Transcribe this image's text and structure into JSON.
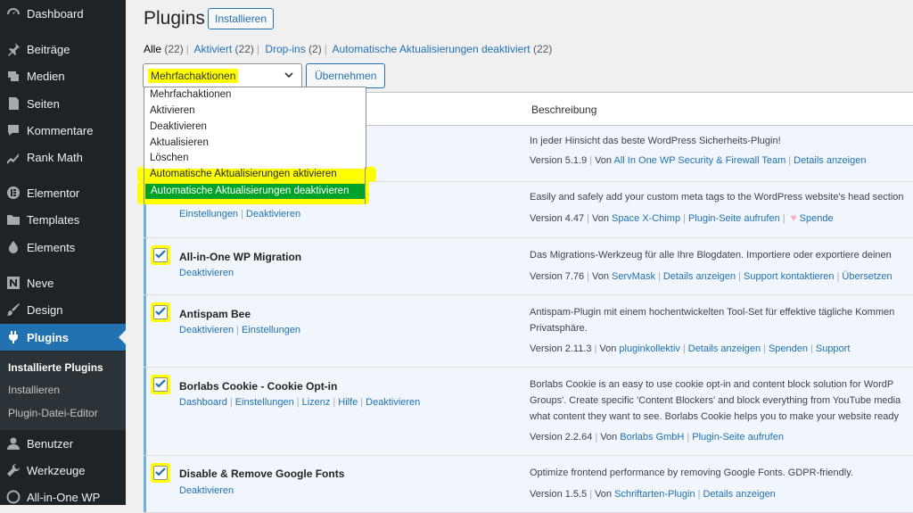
{
  "sidebar": {
    "items": [
      {
        "label": "Dashboard",
        "icon": "dashboard-icon"
      },
      {
        "label": "Beiträge",
        "icon": "pin-icon"
      },
      {
        "label": "Medien",
        "icon": "media-icon"
      },
      {
        "label": "Seiten",
        "icon": "page-icon"
      },
      {
        "label": "Kommentare",
        "icon": "comment-icon"
      },
      {
        "label": "Rank Math",
        "icon": "chart-icon"
      },
      {
        "label": "Elementor",
        "icon": "elementor-icon"
      },
      {
        "label": "Templates",
        "icon": "folder-icon"
      },
      {
        "label": "Elements",
        "icon": "elements-icon"
      },
      {
        "label": "Neve",
        "icon": "neve-icon"
      },
      {
        "label": "Design",
        "icon": "brush-icon"
      },
      {
        "label": "Plugins",
        "icon": "plug-icon"
      },
      {
        "label": "Benutzer",
        "icon": "user-icon"
      },
      {
        "label": "Werkzeuge",
        "icon": "wrench-icon"
      },
      {
        "label": "All-in-One WP",
        "icon": "shield-icon"
      }
    ],
    "submenu": [
      "Installierte Plugins",
      "Installieren",
      "Plugin-Datei-Editor"
    ]
  },
  "header": {
    "title": "Plugins",
    "add_button": "Installieren"
  },
  "filters": {
    "all": "Alle",
    "all_count": "(22)",
    "active": "Aktiviert",
    "active_count": "(22)",
    "dropins": "Drop-ins",
    "dropins_count": "(2)",
    "autoupdate": "Automatische Aktualisierungen deaktiviert",
    "autoupdate_count": "(22)",
    "sep": "|"
  },
  "bulk": {
    "selected": "Mehrfachaktionen",
    "apply": "Übernehmen",
    "options": [
      "Mehrfachaktionen",
      "Aktivieren",
      "Deaktivieren",
      "Aktualisieren",
      "Löschen",
      "Automatische Aktualisierungen aktivieren",
      "Automatische Aktualisierungen deaktivieren"
    ]
  },
  "table": {
    "col_description": "Beschreibung",
    "rows": [
      {
        "name": "",
        "actions": [],
        "desc": [
          "In jeder Hinsicht das beste WordPress Sicherheits-Plugin!"
        ],
        "version": "Version 5.1.9",
        "by": "Von",
        "links": [
          "All In One WP Security & Firewall Team",
          "Details anzeigen"
        ]
      },
      {
        "name": "",
        "actions": [
          "Einstellungen",
          "Deaktivieren"
        ],
        "desc": [
          "Easily and safely add your custom meta tags to the WordPress website's head section"
        ],
        "version": "Version 4.47",
        "by": "Von",
        "links": [
          "Space X-Chimp",
          "Plugin-Seite aufrufen",
          "Spende"
        ]
      },
      {
        "name": "All-in-One WP Migration",
        "actions": [
          "Deaktivieren"
        ],
        "desc": [
          "Das Migrations-Werkzeug für alle Ihre Blogdaten. Importiere oder exportiere deinen"
        ],
        "version": "Version 7.76",
        "by": "Von",
        "links": [
          "ServMask",
          "Details anzeigen",
          "Support kontaktieren",
          "Übersetzen"
        ]
      },
      {
        "name": "Antispam Bee",
        "actions": [
          "Deaktivieren",
          "Einstellungen"
        ],
        "desc": [
          "Antispam-Plugin mit einem hochentwickelten Tool-Set für effektive tägliche Kommen",
          "Privatsphäre."
        ],
        "version": "Version 2.11.3",
        "by": "Von",
        "links": [
          "pluginkollektiv",
          "Details anzeigen",
          "Spenden",
          "Support"
        ]
      },
      {
        "name": "Borlabs Cookie - Cookie Opt-in",
        "actions": [
          "Dashboard",
          "Einstellungen",
          "Lizenz",
          "Hilfe",
          "Deaktivieren"
        ],
        "desc": [
          "Borlabs Cookie is an easy to use cookie opt-in and content block solution for WordP",
          "Groups'. Create specific 'Content Blockers' and block everything from YouTube media",
          "what content they want to see. Borlabs Cookie helps you to make your website ready"
        ],
        "version": "Version 2.2.64",
        "by": "Von",
        "links": [
          "Borlabs GmbH",
          "Plugin-Seite aufrufen"
        ]
      },
      {
        "name": "Disable & Remove Google Fonts",
        "actions": [
          "Deaktivieren"
        ],
        "desc": [
          "Optimize frontend performance by removing Google Fonts. GDPR-friendly."
        ],
        "version": "Version 1.5.5",
        "by": "Von",
        "links": [
          "Schriftarten-Plugin",
          "Details anzeigen"
        ]
      }
    ]
  },
  "colors": {
    "sidebar_bg": "#1d2327",
    "accent": "#2271b1",
    "highlight_yellow": "#ffff00",
    "highlight_green": "#00a32a"
  }
}
